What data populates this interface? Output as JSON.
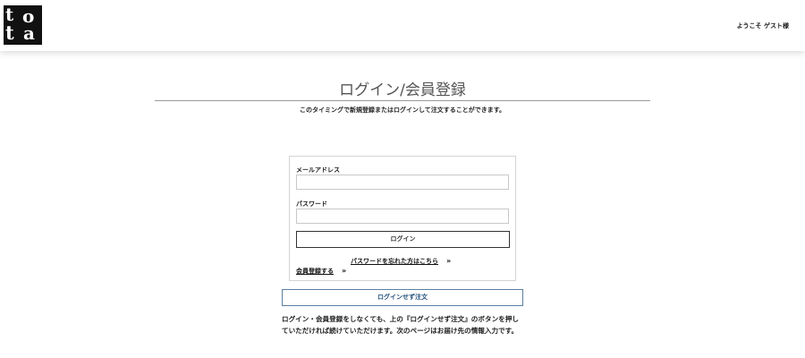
{
  "header": {
    "logo_letters": [
      "t",
      "o",
      "t",
      "a"
    ],
    "welcome": "ようこそ ゲスト様"
  },
  "main": {
    "title": "ログイン/会員登録",
    "subtitle": "このタイミングで新規登録またはログインして注文することができます。"
  },
  "login_form": {
    "email_label": "メールアドレス",
    "email_value": "",
    "password_label": "パスワード",
    "password_value": "",
    "login_button": "ログイン",
    "forgot_link": "パスワードを忘れた方はこちら",
    "register_link": "会員登録する",
    "chevron": "»"
  },
  "guest": {
    "button": "ログインせず注文",
    "note_line1": "ログイン・会員登録をしなくても、上の『ログインせず注文』のボタンを押し",
    "note_line2": "ていただければ続けていただけます。次のページはお届け先の情報入力です。"
  },
  "colors": {
    "guest_border": "#5a7fa0",
    "guest_text": "#1f4e79",
    "logo_bg": "#111111"
  },
  "icons": [
    "chevron-double-right-icon"
  ]
}
